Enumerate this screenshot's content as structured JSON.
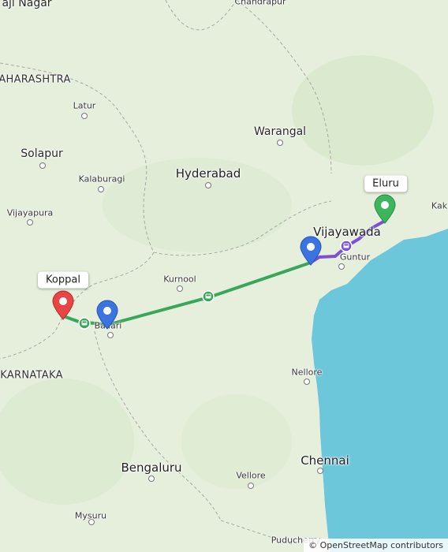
{
  "map": {
    "attribution": "© OpenStreetMap contributors",
    "colors": {
      "land": "#e6efdc",
      "sea": "#6cc7da",
      "route_green": "#3aa65a",
      "route_purple": "#7b4fd6",
      "marker_red": "#e84545",
      "marker_blue": "#3b74e0",
      "marker_green": "#3cb55c"
    }
  },
  "places": {
    "ajinagar": "aji Nagar",
    "chandrapur": "Chandrapur",
    "maharashtra": "AHARASHTRA",
    "latur": "Latur",
    "warangal": "Warangal",
    "solapur": "Solapur",
    "hyderabad": "Hyderabad",
    "kalaburagi": "Kalaburagi",
    "vijayapura": "Vijayapura",
    "kakinada": "Kak",
    "vijayawada": "Vijayawada",
    "guntur": "Guntur",
    "kurnool": "Kurnool",
    "ballari": "Ballari",
    "karnataka": "KARNATAKA",
    "nellore": "Nellore",
    "chennai": "Chennai",
    "bengaluru": "Bengaluru",
    "vellore": "Vellore",
    "mysuru": "Mysuru",
    "puducherry": "Puducherry"
  },
  "markers": {
    "koppal": {
      "label": "Koppal",
      "color": "red"
    },
    "eluru": {
      "label": "Eluru",
      "color": "green"
    },
    "ballari_stop": {
      "color": "blue"
    },
    "vijayawada_stop": {
      "color": "blue"
    }
  }
}
